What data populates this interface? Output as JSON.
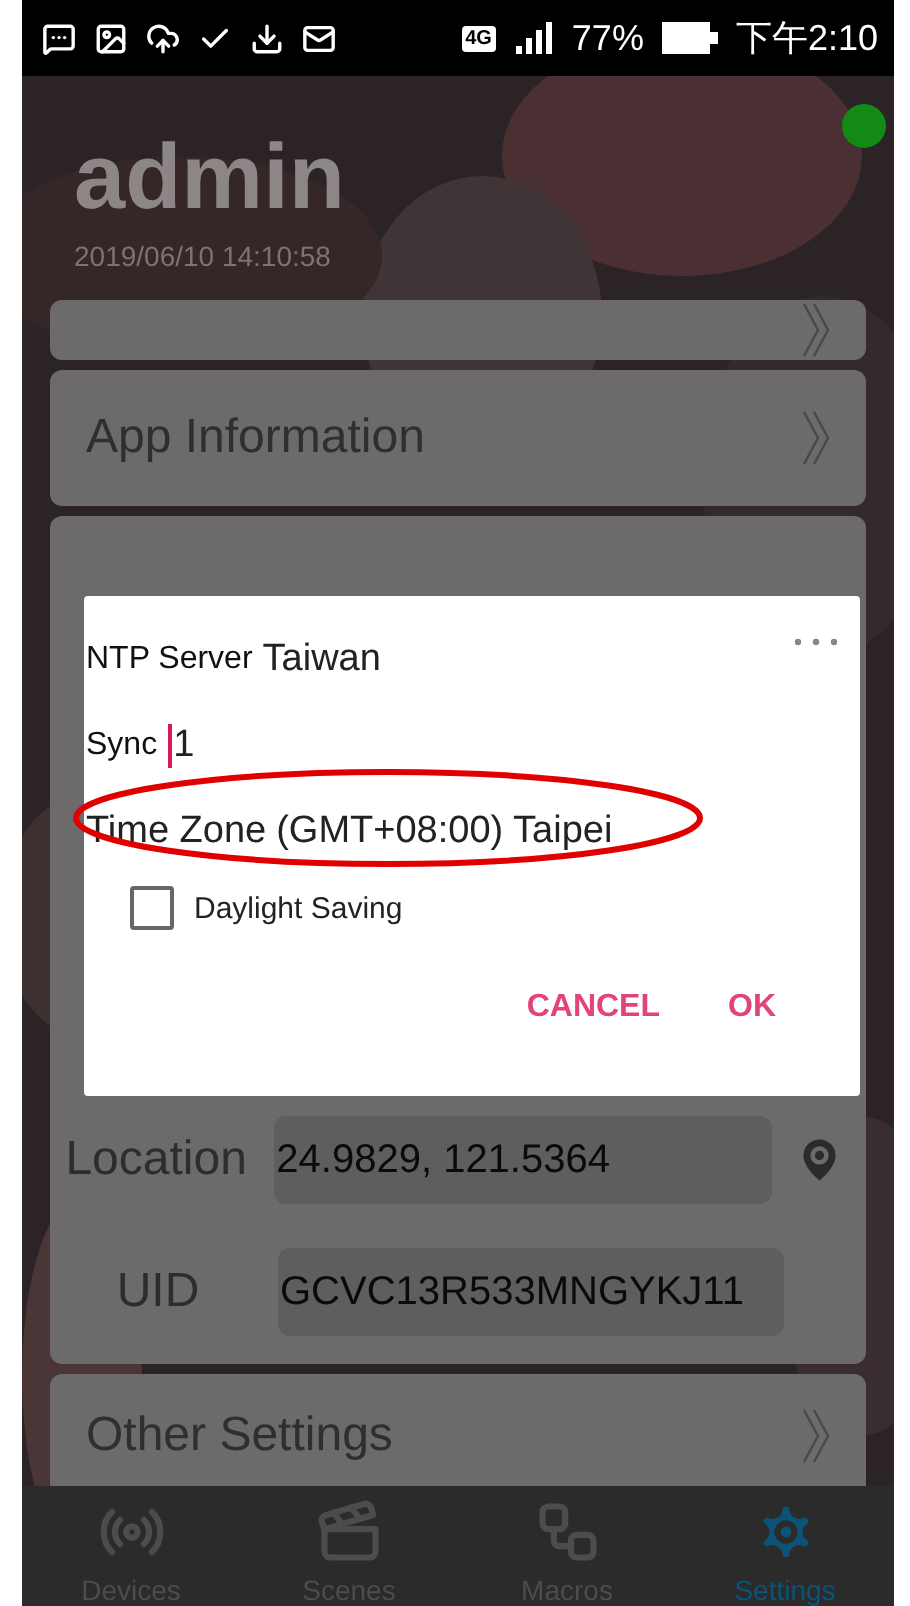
{
  "status_bar": {
    "network": "4G",
    "battery": "77%",
    "time": "下午2:10"
  },
  "header": {
    "user": "admin",
    "datetime": "2019/06/10 14:10:58",
    "online": true
  },
  "menu": [
    {
      "kind": "link"
    },
    {
      "kind": "link",
      "label": "App Information"
    }
  ],
  "system": {
    "fields": [
      {
        "label": "Location",
        "value": "24.9829, 121.5364",
        "kind": "location"
      },
      {
        "label": "UID",
        "value": "GCVC13R533MNGYKJ11",
        "kind": "plain"
      }
    ]
  },
  "other_settings": {
    "label": "Other Settings"
  },
  "dialog": {
    "ntp_server": {
      "label": "NTP Server",
      "value": "Taiwan"
    },
    "sync": {
      "label": "Sync",
      "value": "1"
    },
    "time_zone": {
      "label": "Time Zone",
      "value": "(GMT+08:00) Taipei",
      "highlighted": true
    },
    "daylight_saving": {
      "label": "Daylight Saving",
      "checked": false
    },
    "buttons": [
      "CANCEL",
      "OK"
    ]
  },
  "nav": [
    {
      "label": "Devices",
      "kind": "devices",
      "selected": false
    },
    {
      "label": "Scenes",
      "kind": "scenes",
      "selected": false
    },
    {
      "label": "Macros",
      "kind": "macros",
      "selected": false
    },
    {
      "label": "Settings",
      "kind": "settings",
      "selected": true
    }
  ]
}
